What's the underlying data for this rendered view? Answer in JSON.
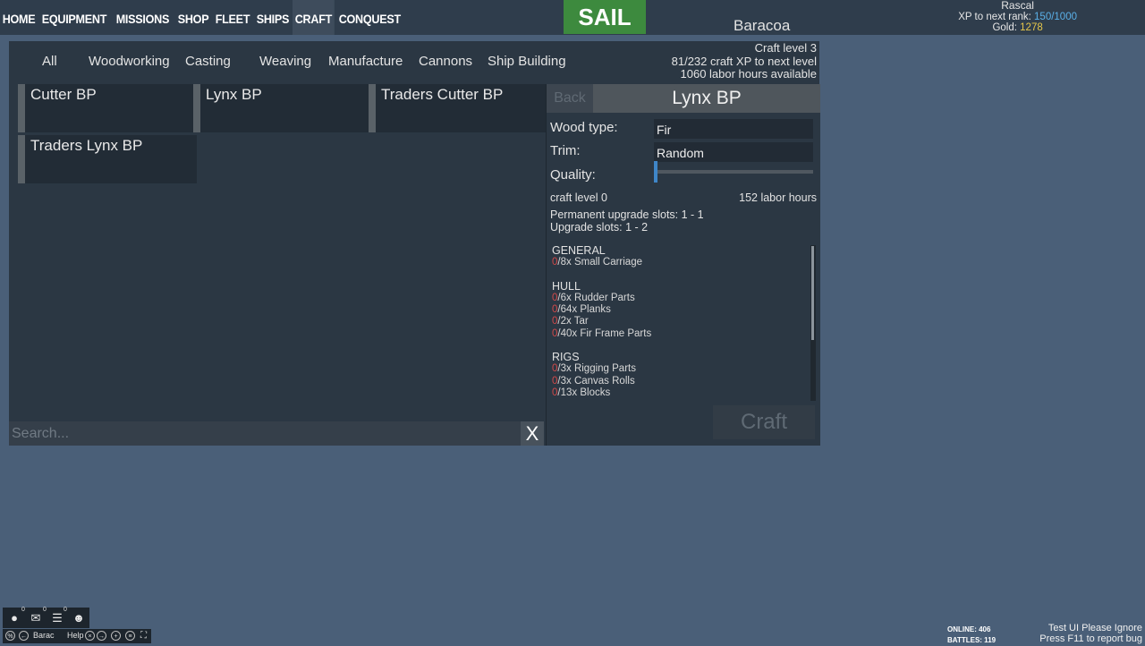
{
  "nav": [
    "HOME",
    "EQUIPMENT",
    "MISSIONS",
    "SHOP",
    "FLEET",
    "SHIPS",
    "CRAFT",
    "CONQUEST"
  ],
  "sail_label": "SAIL",
  "port": "Baracoa",
  "player": {
    "name": "Rascal",
    "xp_label": "XP to next rank:",
    "xp_value": "150/1000",
    "gold_label": "Gold:",
    "gold_value": "1278"
  },
  "tabs": [
    "All",
    "Woodworking",
    "Casting",
    "Weaving",
    "Manufacture",
    "Cannons",
    "Ship Building"
  ],
  "craft_info": {
    "level": "Craft level 3",
    "xp": "81/232 craft XP to next level",
    "labor": "1060 labor hours available"
  },
  "blueprints": [
    "Cutter BP",
    "Lynx BP",
    "Traders Cutter BP",
    "Traders Lynx BP"
  ],
  "search_placeholder": "Search...",
  "clear_label": "X",
  "detail": {
    "back_label": "Back",
    "title": "Lynx BP",
    "wood_label": "Wood type:",
    "wood_value": "Fir",
    "trim_label": "Trim:",
    "trim_value": "Random",
    "quality_label": "Quality:",
    "quality_level": 0,
    "craft_level": "craft level 0",
    "labor_hours": "152 labor hours",
    "perm_slots": "Permanent upgrade slots: 1 - 1",
    "upgrade_slots": "Upgrade slots: 1 - 2",
    "groups": [
      {
        "name": "GENERAL",
        "items": [
          {
            "have": "0",
            "need": "/8x Small Carriage"
          }
        ]
      },
      {
        "name": "HULL",
        "items": [
          {
            "have": "0",
            "need": "/6x Rudder Parts"
          },
          {
            "have": "0",
            "need": "/64x Planks"
          },
          {
            "have": "0",
            "need": "/2x Tar"
          },
          {
            "have": "0",
            "need": "/40x Fir Frame Parts"
          }
        ]
      },
      {
        "name": "RIGS",
        "items": [
          {
            "have": "0",
            "need": "/3x Rigging Parts"
          },
          {
            "have": "0",
            "need": "/3x Canvas Rolls"
          },
          {
            "have": "0",
            "need": "/13x Blocks"
          }
        ]
      }
    ],
    "craft_label": "Craft"
  },
  "bottom": {
    "counts": [
      "0",
      "0",
      "0"
    ],
    "port_short": "Barac",
    "help": "Help"
  },
  "stats": {
    "online": "ONLINE: 406",
    "battles": "BATTLES: 119"
  },
  "note": {
    "line1": "Test UI Please Ignore",
    "line2": "Press F11 to report bug"
  }
}
